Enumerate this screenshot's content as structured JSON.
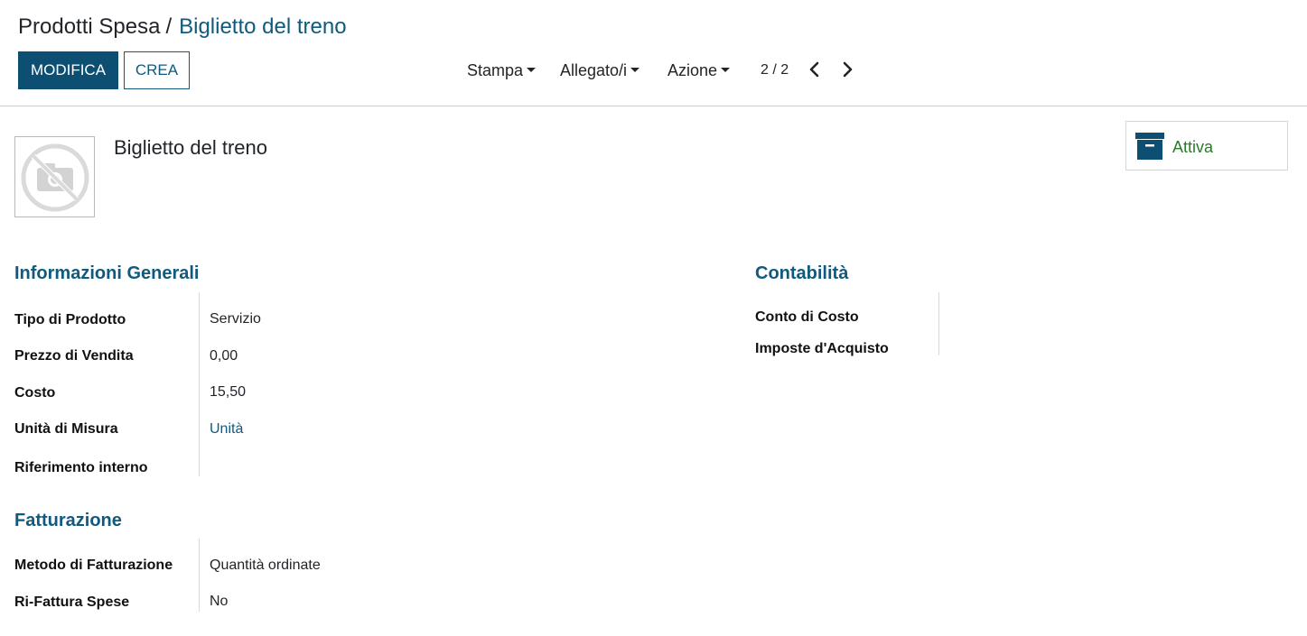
{
  "breadcrumb": {
    "parent": "Prodotti Spesa",
    "separator": "/",
    "current": "Biglietto del treno"
  },
  "toolbar": {
    "edit_label": "MODIFICA",
    "create_label": "CREA",
    "print_label": "Stampa",
    "attachments_label": "Allegato/i",
    "action_label": "Azione"
  },
  "pager": {
    "value": "2 / 2",
    "prev_icon": "chevron-left-icon",
    "next_icon": "chevron-right-icon"
  },
  "record": {
    "name": "Biglietto del treno",
    "image_icon": "no-image-camera-icon",
    "active_button": {
      "label": "Attiva",
      "icon": "archive-icon",
      "icon_color": "#0c4f73",
      "label_color": "#2a7a2a"
    }
  },
  "general": {
    "title": "Informazioni Generali",
    "fields": [
      {
        "label": "Tipo di Prodotto",
        "value": "Servizio"
      },
      {
        "label": "Prezzo di Vendita",
        "value": "0,00"
      },
      {
        "label": "Costo",
        "value": "15,50"
      },
      {
        "label": "Unità di Misura",
        "value": "Unità"
      },
      {
        "label": "Riferimento interno",
        "value": ""
      }
    ]
  },
  "accounting": {
    "title": "Contabilità",
    "fields": [
      {
        "label": "Conto di Costo",
        "value": ""
      },
      {
        "label": "Imposte d'Acquisto",
        "value": ""
      }
    ]
  },
  "invoicing": {
    "title": "Fatturazione",
    "fields": [
      {
        "label": "Metodo di Fatturazione",
        "value": "Quantità ordinate"
      },
      {
        "label": "Ri-Fattura Spese",
        "value": "No"
      }
    ]
  },
  "colors": {
    "brand": "#0c4f73",
    "link": "#0f5a7e",
    "active_green": "#2a7a2a"
  }
}
